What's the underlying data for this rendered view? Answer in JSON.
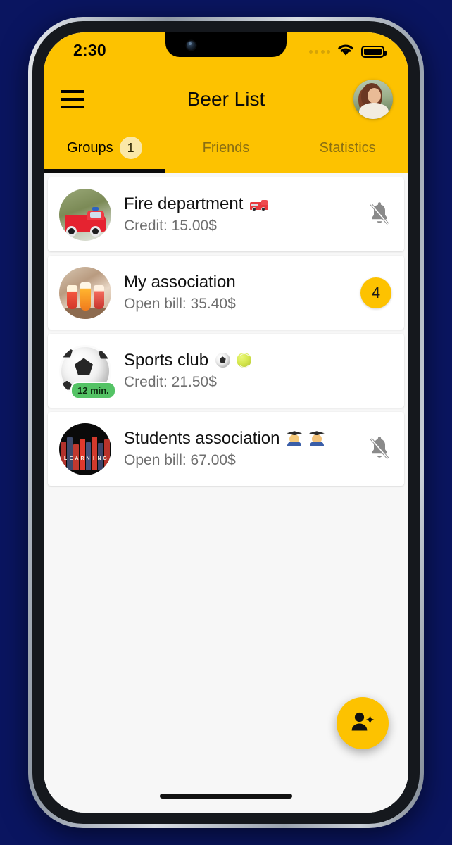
{
  "status_bar": {
    "time": "2:30",
    "signal_icon": "signal-dots-icon",
    "wifi_icon": "wifi-icon",
    "battery_icon": "battery-full-icon"
  },
  "app_bar": {
    "menu_icon": "hamburger-menu-icon",
    "title": "Beer List",
    "avatar_icon": "user-avatar"
  },
  "tabs": [
    {
      "label": "Groups",
      "badge": "1",
      "active": true
    },
    {
      "label": "Friends",
      "badge": "",
      "active": false
    },
    {
      "label": "Statistics",
      "badge": "",
      "active": false
    }
  ],
  "groups": [
    {
      "title": "Fire department",
      "emoji": "fire-engine-emoji",
      "subtitle": "Credit: 15.00$",
      "trailing_type": "bell-off",
      "trailing_value": "",
      "thumb": "fire-truck-photo",
      "time_badge": ""
    },
    {
      "title": "My association",
      "emoji": "",
      "subtitle": "Open bill: 35.40$",
      "trailing_type": "count",
      "trailing_value": "4",
      "thumb": "cheers-drinks-photo",
      "time_badge": ""
    },
    {
      "title": "Sports club",
      "emoji": "soccer-tennis-emoji",
      "subtitle": "Credit: 21.50$",
      "trailing_type": "none",
      "trailing_value": "",
      "thumb": "soccer-ball-photo",
      "time_badge": "12 min."
    },
    {
      "title": "Students association",
      "emoji": "graduates-emoji",
      "subtitle": "Open bill: 67.00$",
      "trailing_type": "bell-off",
      "trailing_value": "",
      "thumb": "books-photo",
      "time_badge": ""
    }
  ],
  "fab": {
    "icon": "person-add-icon",
    "label": ""
  },
  "colors": {
    "brand_yellow": "#FDC200",
    "page_background": "#0A1560",
    "card_white": "#FFFFFF",
    "content_background": "#F7F7F7",
    "badge_light_yellow": "#FAE8A8",
    "time_badge_green": "#54C365",
    "muted_text": "#6F6F6F"
  }
}
